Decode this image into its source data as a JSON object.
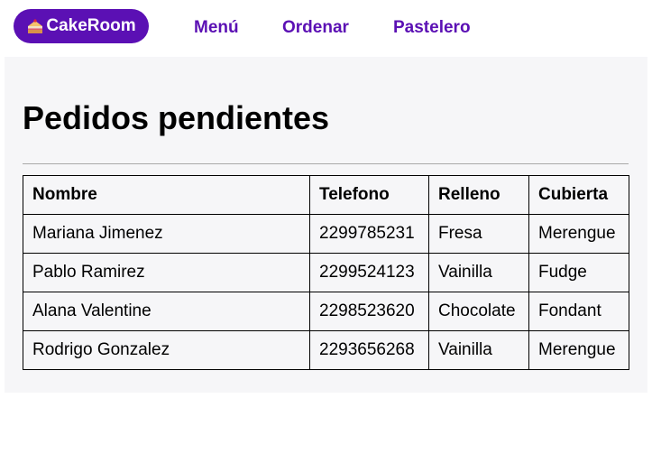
{
  "nav": {
    "brand_label": "CakeRoom",
    "brand_icon": "cake-icon",
    "links": [
      {
        "label": "Menú"
      },
      {
        "label": "Ordenar"
      },
      {
        "label": "Pastelero"
      }
    ]
  },
  "main": {
    "title": "Pedidos pendientes",
    "table": {
      "headers": [
        "Nombre",
        "Telefono",
        "Relleno",
        "Cubierta"
      ],
      "rows": [
        [
          "Mariana Jimenez",
          "2299785231",
          "Fresa",
          "Merengue"
        ],
        [
          "Pablo Ramirez",
          "2299524123",
          "Vainilla",
          "Fudge"
        ],
        [
          "Alana Valentine",
          "2298523620",
          "Chocolate",
          "Fondant"
        ],
        [
          "Rodrigo Gonzalez",
          "2293656268",
          "Vainilla",
          "Merengue"
        ]
      ]
    }
  },
  "colors": {
    "brand": "#5b10b4",
    "panel_background": "#f6f6f8"
  }
}
